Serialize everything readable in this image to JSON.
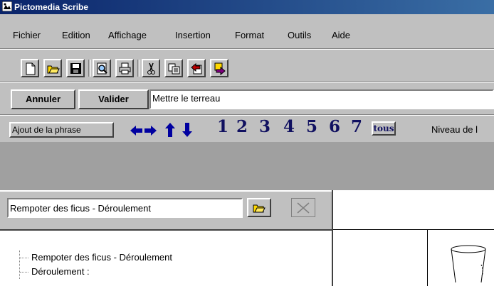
{
  "window": {
    "title": "Pictomedia Scribe"
  },
  "menu": {
    "items": [
      {
        "label": "Fichier"
      },
      {
        "label": "Edition"
      },
      {
        "label": "Affichage"
      },
      {
        "label": "Insertion"
      },
      {
        "label": "Format"
      },
      {
        "label": "Outils"
      },
      {
        "label": "Aide"
      }
    ]
  },
  "toolbar": {
    "icons": [
      "new-file-icon",
      "open-folder-icon",
      "save-icon",
      "print-preview-icon",
      "print-icon",
      "cut-icon",
      "copy-icon",
      "undo-icon",
      "redo-icon"
    ]
  },
  "edit_bar": {
    "cancel_label": "Annuler",
    "validate_label": "Valider",
    "sentence_value": "Mettre le terreau"
  },
  "phrase_bar": {
    "add_label": "Ajout de la phrase",
    "numbers": [
      "1",
      "2",
      "3",
      "4",
      "5",
      "6",
      "7"
    ],
    "all_label": "tous",
    "level_label": "Niveau de l"
  },
  "left_panel": {
    "title_value": "Rempoter des ficus - Déroulement",
    "tree": [
      {
        "label": "Rempoter des ficus - Déroulement"
      },
      {
        "label": "Déroulement :"
      }
    ]
  },
  "colors": {
    "face": "#c0c0c0",
    "title_bg": "#0a246a",
    "icon_navy": "#101060",
    "arrow_blue": "#0000a0"
  }
}
